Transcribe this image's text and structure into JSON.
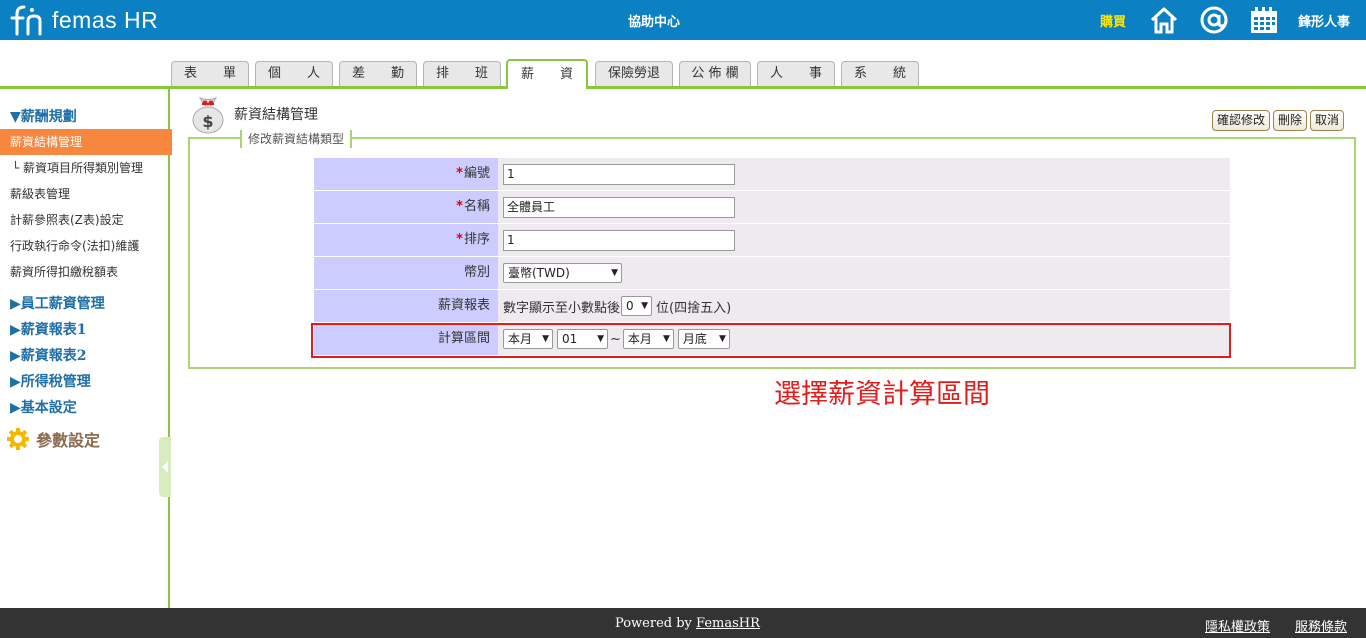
{
  "header": {
    "logo_text": "femas HR",
    "help_center": "協助中心",
    "buy": "購買",
    "company": "鋒形人事",
    "icons": [
      "home-icon",
      "at-icon",
      "calendar-icon"
    ],
    "bg_color": "#0b80c2"
  },
  "tabs": [
    {
      "label": "表　　單"
    },
    {
      "label": "個　　人"
    },
    {
      "label": "差　　勤"
    },
    {
      "label": "排　　班"
    },
    {
      "label": "薪　　資",
      "active": true
    },
    {
      "label": "保險勞退"
    },
    {
      "label": "公 佈 欄"
    },
    {
      "label": "人　　事"
    },
    {
      "label": "系　　統"
    }
  ],
  "sidebar": {
    "section_main": "▼薪酬規劃",
    "items": [
      {
        "label": "薪資結構管理",
        "active": true
      },
      {
        "label": "└ 薪資項目所得類別管理"
      },
      {
        "label": "薪級表管理"
      },
      {
        "label": "計薪參照表(Z表)設定"
      },
      {
        "label": "行政執行命令(法扣)維護"
      },
      {
        "label": "薪資所得扣繳稅額表"
      }
    ],
    "sections": [
      {
        "label": "▶員工薪資管理"
      },
      {
        "label": "▶薪資報表1"
      },
      {
        "label": "▶薪資報表2"
      },
      {
        "label": "▶所得稅管理"
      },
      {
        "label": "▶基本設定"
      }
    ],
    "param": "參數設定"
  },
  "main": {
    "title": "薪資結構管理",
    "legend": "修改薪資結構類型",
    "buttons": {
      "confirm": "確認修改",
      "delete": "刪除",
      "cancel": "取消"
    },
    "form": {
      "required_mark": "*",
      "id_label": "編號",
      "id_value": "1",
      "name_label": "名稱",
      "name_value": "全體員工",
      "order_label": "排序",
      "order_value": "1",
      "currency_label": "幣別",
      "currency_value": "臺幣(TWD)",
      "report_label": "薪資報表",
      "report_prefix": "數字顯示至小數點後",
      "report_decimal": "0",
      "report_suffix": "位(四捨五入)",
      "period_label": "計算區間",
      "period_start_month": "本月",
      "period_start_day": "01",
      "period_sep": "~",
      "period_end_month": "本月",
      "period_end_day": "月底"
    },
    "annotation": "選擇薪資計算區間",
    "annotation_color": "#e21b1b"
  },
  "footer": {
    "powered_prefix": "Powered by ",
    "powered_link": "FemasHR",
    "privacy": "隱私權政策",
    "terms": "服務條款"
  }
}
